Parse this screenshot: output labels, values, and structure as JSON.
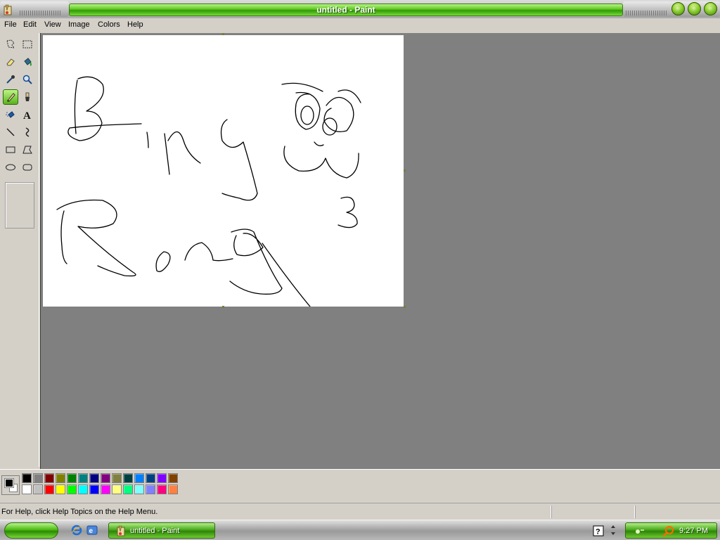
{
  "window": {
    "title": "untitled - Paint"
  },
  "menu": {
    "items": [
      "File",
      "Edit",
      "View",
      "Image",
      "Colors",
      "Help"
    ]
  },
  "tools": [
    {
      "name": "free-form-select"
    },
    {
      "name": "rectangle-select"
    },
    {
      "name": "eraser"
    },
    {
      "name": "fill-with-color"
    },
    {
      "name": "pick-color"
    },
    {
      "name": "magnifier"
    },
    {
      "name": "pencil",
      "active": true
    },
    {
      "name": "brush"
    },
    {
      "name": "airbrush"
    },
    {
      "name": "text"
    },
    {
      "name": "line"
    },
    {
      "name": "curve"
    },
    {
      "name": "rectangle"
    },
    {
      "name": "polygon"
    },
    {
      "name": "ellipse"
    },
    {
      "name": "rounded-rectangle"
    }
  ],
  "canvas": {
    "drawing": "handwritten scribble"
  },
  "palette": {
    "foreground": "#000000",
    "background": "#ffffff",
    "colors_top": [
      "#000000",
      "#808080",
      "#800000",
      "#808000",
      "#008000",
      "#008080",
      "#000080",
      "#800080",
      "#808040",
      "#004040",
      "#0080ff",
      "#004080",
      "#8000ff",
      "#804000"
    ],
    "colors_bottom": [
      "#ffffff",
      "#c0c0c0",
      "#ff0000",
      "#ffff00",
      "#00ff00",
      "#00ffff",
      "#0000ff",
      "#ff00ff",
      "#ffff80",
      "#00ff80",
      "#80ffff",
      "#8080ff",
      "#ff0080",
      "#ff8040"
    ]
  },
  "status": {
    "help_text": "For Help, click Help Topics on the Help Menu."
  },
  "taskbar": {
    "task_label": "untitled - Paint",
    "clock": "9:27 PM"
  }
}
